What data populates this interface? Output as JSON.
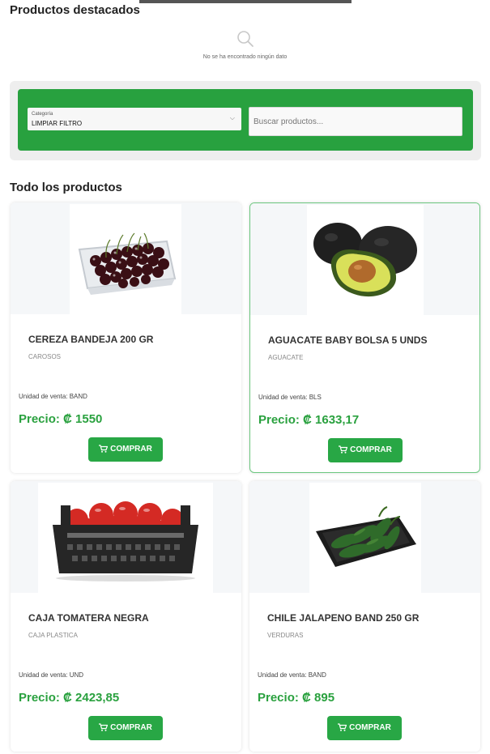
{
  "featured": {
    "title": "Productos destacados",
    "empty_message": "No se ha encontrado ningún dato"
  },
  "filters": {
    "category_label": "Categoría",
    "category_value": "LIMPIAR FILTRO",
    "search_placeholder": "Buscar productos..."
  },
  "all_products": {
    "title": "Todo los productos",
    "unit_prefix": "Unidad de venta:",
    "price_prefix": "Precio: ₡",
    "buy_label": "COMPRAR",
    "items": [
      {
        "name": "CEREZA BANDEJA 200 GR",
        "category": "CAROSOS",
        "unit": "Unidad de venta: BAND",
        "price": "Precio: ₡ 1550"
      },
      {
        "name": "AGUACATE BABY BOLSA 5 UNDS",
        "category": "AGUACATE",
        "unit": "Unidad de venta: BLS",
        "price": "Precio: ₡ 1633,17"
      },
      {
        "name": "CAJA TOMATERA NEGRA",
        "category": "CAJA PLASTICA",
        "unit": "Unidad de venta: UND",
        "price": "Precio: ₡ 2423,85"
      },
      {
        "name": "CHILE JALAPENO BAND 250 GR",
        "category": "VERDURAS",
        "unit": "Unidad de venta: BAND",
        "price": "Precio: ₡ 895"
      }
    ]
  },
  "colors": {
    "accent": "#28a745",
    "price": "#2aa13f",
    "filter_bg": "#28a13f"
  }
}
